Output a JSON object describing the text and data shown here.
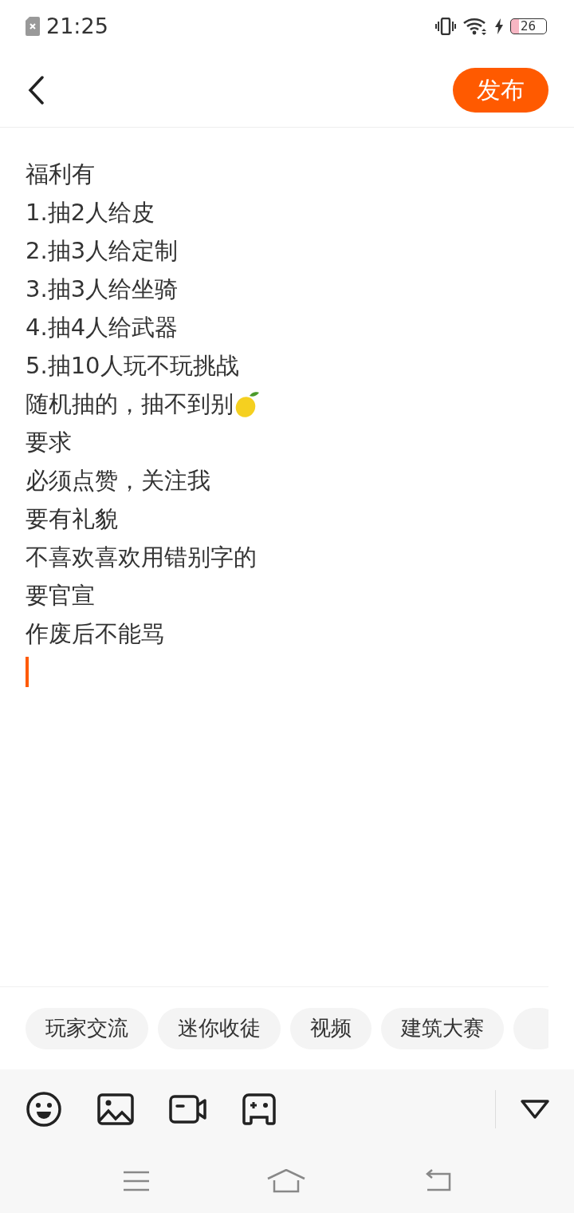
{
  "status_bar": {
    "time": "21:25",
    "battery": "26"
  },
  "header": {
    "publish_button": "发布"
  },
  "editor": {
    "lines": [
      {
        "text": "福利有",
        "emoji": false
      },
      {
        "text": "1.抽2人给皮",
        "emoji": false
      },
      {
        "text": "2.抽3人给定制",
        "emoji": false
      },
      {
        "text": "3.抽3人给坐骑",
        "emoji": false
      },
      {
        "text": "4.抽4人给武器",
        "emoji": false
      },
      {
        "text": "5.抽10人玩不玩挑战",
        "emoji": false
      },
      {
        "text": "随机抽的，抽不到别",
        "emoji": true
      },
      {
        "text": "要求",
        "emoji": false
      },
      {
        "text": "必须点赞，关注我",
        "emoji": false
      },
      {
        "text": "要有礼貌",
        "emoji": false
      },
      {
        "text": "不喜欢喜欢用错别字的",
        "emoji": false
      },
      {
        "text": "要官宣",
        "emoji": false
      },
      {
        "text": "作废后不能骂",
        "emoji": false
      }
    ]
  },
  "topics": [
    "玩家交流",
    "迷你收徒",
    "视频",
    "建筑大赛"
  ]
}
